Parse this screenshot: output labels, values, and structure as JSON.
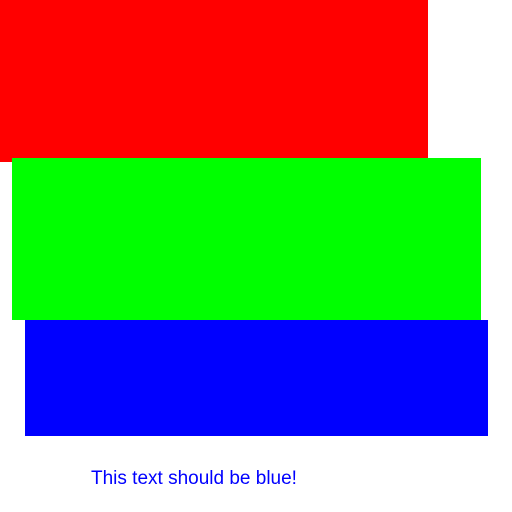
{
  "blocks": [
    {
      "name": "red-block",
      "color": "#ff0000"
    },
    {
      "name": "green-block",
      "color": "#00ff00"
    },
    {
      "name": "blue-block",
      "color": "#0000ff"
    }
  ],
  "caption": {
    "text": "This text should be blue!",
    "color": "#0000ff"
  }
}
